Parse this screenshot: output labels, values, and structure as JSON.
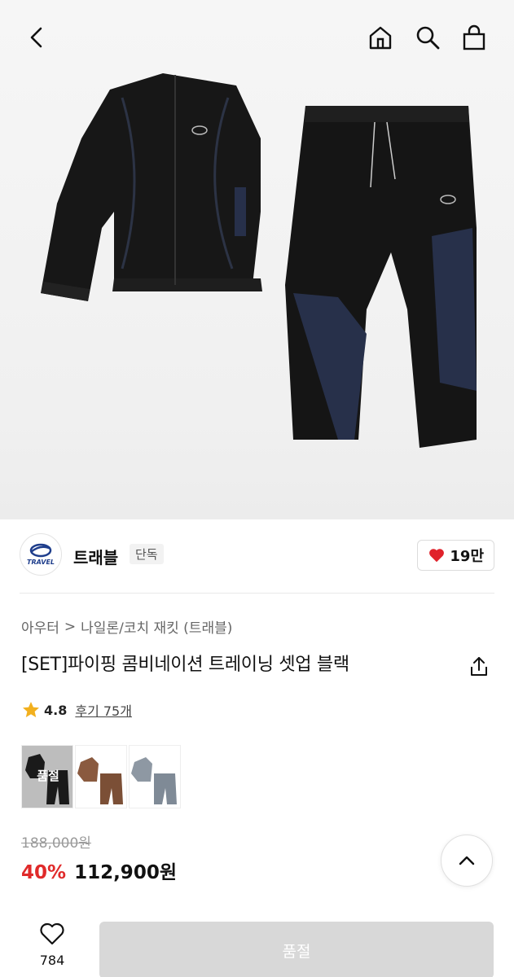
{
  "brand": {
    "name": "트래블",
    "badge": "단독",
    "logo_text": "TRAVEL",
    "likes": "19만"
  },
  "breadcrumb": {
    "category": "아우터",
    "separator": ">",
    "subcategory": "나일론/코치 재킷 (트래블)"
  },
  "product": {
    "title": "[SET]파이핑 콤비네이션 트레이닝 셋업 블랙"
  },
  "rating": {
    "score": "4.8",
    "reviews": "후기 75개"
  },
  "colors": [
    {
      "name": "black",
      "badge": "품절"
    },
    {
      "name": "brown",
      "badge": ""
    },
    {
      "name": "grey",
      "badge": ""
    }
  ],
  "price": {
    "original": "188,000원",
    "discount": "40%",
    "sale": "112,900원"
  },
  "bottom": {
    "wish_count": "784",
    "buy_label": "품절"
  },
  "icons": [
    "back-icon",
    "home-icon",
    "search-icon",
    "bag-icon",
    "heart-icon",
    "share-icon",
    "star-icon",
    "chevron-up-icon"
  ],
  "palette": {
    "accent_red": "#e02a2a",
    "heart_red": "#e0222b",
    "star": "#f2b01e"
  }
}
